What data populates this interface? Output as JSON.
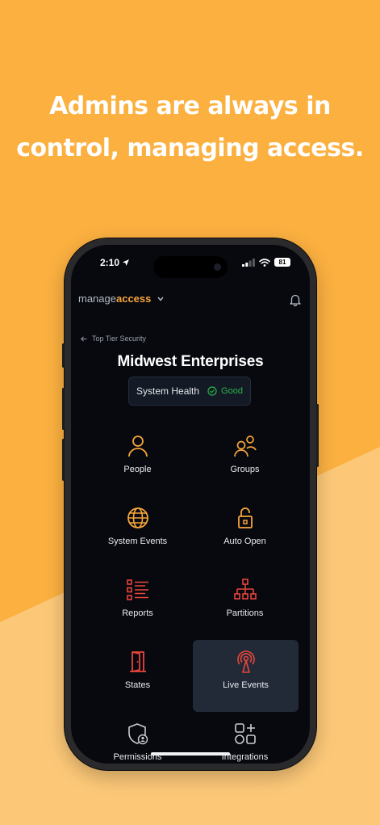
{
  "headline": {
    "line1": "Admins are always in",
    "line2": "control, managing access."
  },
  "status_bar": {
    "time": "2:10",
    "battery": "81",
    "icons": [
      "location-arrow-icon",
      "signal-icon",
      "wifi-icon",
      "battery-icon"
    ]
  },
  "app": {
    "brand_plain": "manage",
    "brand_accent": "access",
    "back_label": "Top Tier Security",
    "org_name": "Midwest Enterprises",
    "health_label": "System Health",
    "health_status": "Good"
  },
  "menu": [
    {
      "label": "People",
      "icon": "person-icon",
      "color": "#f7a53b"
    },
    {
      "label": "Groups",
      "icon": "groups-icon",
      "color": "#f7a53b"
    },
    {
      "label": "System Events",
      "icon": "globe-icon",
      "color": "#f7a53b"
    },
    {
      "label": "Auto Open",
      "icon": "unlock-icon",
      "color": "#f7a53b"
    },
    {
      "label": "Reports",
      "icon": "list-icon",
      "color": "#e8453c"
    },
    {
      "label": "Partitions",
      "icon": "hierarchy-icon",
      "color": "#e8453c"
    },
    {
      "label": "States",
      "icon": "door-icon",
      "color": "#e8453c"
    },
    {
      "label": "Live Events",
      "icon": "broadcast-icon",
      "color": "#e8453c",
      "selected": true
    },
    {
      "label": "Permissions",
      "icon": "shield-user-icon",
      "color": "#c9ccd2"
    },
    {
      "label": "Integrations",
      "icon": "apps-icon",
      "color": "#c9ccd2"
    }
  ],
  "colors": {
    "background": "#fbb040",
    "background_lower": "#fcc878",
    "accent": "#f7a53b",
    "alert": "#e8453c",
    "good": "#2bb34a",
    "screen": "#07090f"
  }
}
